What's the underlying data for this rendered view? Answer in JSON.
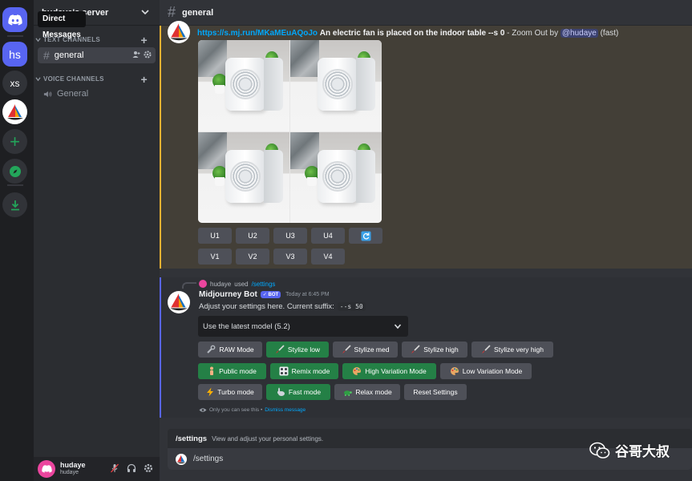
{
  "rail": {
    "tooltip": "Direct Messages",
    "servers": [
      {
        "label": "hs"
      },
      {
        "label": "xs"
      }
    ],
    "icons": [
      "discord-logo-icon",
      "sailboat-server-icon",
      "add-server-icon",
      "compass-icon",
      "download-icon"
    ]
  },
  "sidebar": {
    "server_name": "hudaye's server",
    "text_category": "TEXT CHANNELS",
    "voice_category": "VOICE CHANNELS",
    "text_channels": [
      {
        "label": "general"
      }
    ],
    "voice_channels": [
      {
        "label": "General"
      }
    ]
  },
  "user": {
    "display_name": "hudaye",
    "username": "hudaye"
  },
  "channel": {
    "title": "general"
  },
  "message1": {
    "link": "https://s.mj.run/MKaMEuAQoJo",
    "prompt": "An electric fan is placed on the indoor table --s 0",
    "suffix": " - Zoom Out by ",
    "mention": "@hudaye",
    "speed": " (fast)",
    "u_buttons": [
      "U1",
      "U2",
      "U3",
      "U4"
    ],
    "v_buttons": [
      "V1",
      "V2",
      "V3",
      "V4"
    ]
  },
  "message2": {
    "reply_user": "hudaye",
    "reply_used": "used",
    "reply_command": "/settings",
    "author": "Midjourney Bot",
    "bot_tag": "BOT",
    "timestamp": "Today at 6:45 PM",
    "body": "Adjust your settings here. Current suffix:",
    "suffix_code": "--s 50",
    "select_value": "Use the latest model (5.2)",
    "row1": [
      "RAW Mode",
      "Stylize low",
      "Stylize med",
      "Stylize high",
      "Stylize very high"
    ],
    "row2": [
      "Public mode",
      "Remix mode",
      "High Variation Mode",
      "Low Variation Mode"
    ],
    "row3": [
      "Turbo mode",
      "Fast mode",
      "Relax mode",
      "Reset Settings"
    ],
    "ephemeral_note": "Only you can see this •",
    "dismiss": "Dismiss message"
  },
  "composer": {
    "command": "/settings",
    "command_desc": "View and adjust your personal settings.",
    "input_value": "/settings"
  },
  "watermark": {
    "text": "谷哥大叔"
  },
  "colors": {
    "blurple": "#5865f2",
    "green": "#248046",
    "highlight": "#f0b232"
  }
}
